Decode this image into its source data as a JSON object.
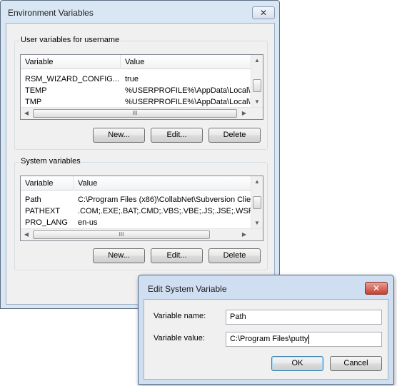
{
  "env_window": {
    "title": "Environment Variables",
    "close_glyph": "✕",
    "user_group": {
      "title": "User variables for username",
      "columns": [
        "Variable",
        "Value"
      ],
      "rows": [
        {
          "name": "RSM_WIZARD_CONFIG...",
          "value": "true"
        },
        {
          "name": "TEMP",
          "value": "%USERPROFILE%\\AppData\\Local\\T"
        },
        {
          "name": "TMP",
          "value": "%USERPROFILE%\\AppData\\Local\\T"
        }
      ],
      "buttons": {
        "new": "New...",
        "edit": "Edit...",
        "delete": "Delete"
      }
    },
    "system_group": {
      "title": "System variables",
      "columns": [
        "Variable",
        "Value"
      ],
      "rows": [
        {
          "name": "Path",
          "value": "C:\\Program Files (x86)\\CollabNet\\Subversion Clie"
        },
        {
          "name": "PATHEXT",
          "value": ".COM;.EXE;.BAT;.CMD;.VBS;.VBE;.JS;.JSE;.WSF"
        },
        {
          "name": "PRO_LANG",
          "value": "en-us"
        }
      ],
      "buttons": {
        "new": "New...",
        "edit": "Edit...",
        "delete": "Delete"
      }
    },
    "scroll_glyphs": {
      "up": "▲",
      "down": "▼",
      "left": "◀",
      "right": "▶",
      "grip": "III"
    }
  },
  "edit_dialog": {
    "title": "Edit System Variable",
    "close_glyph": "✕",
    "name_label": "Variable name:",
    "name_value": "Path",
    "value_label": "Variable value:",
    "value_value": "C:\\Program Files\\putty",
    "ok_label": "OK",
    "cancel_label": "Cancel"
  }
}
